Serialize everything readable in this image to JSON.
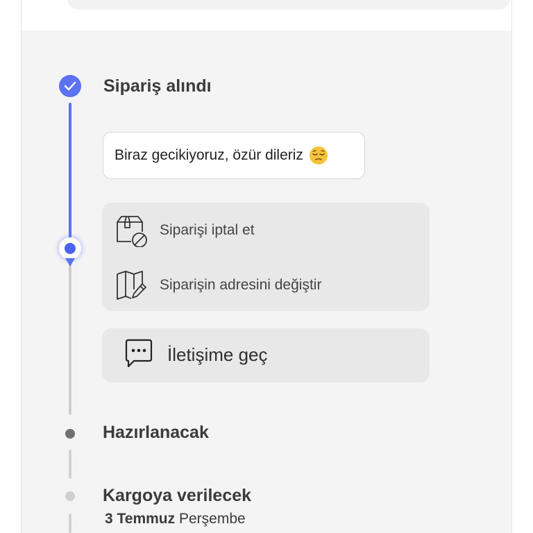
{
  "timeline": {
    "steps": [
      {
        "title": "Sipariş alındı",
        "status": "done"
      },
      {
        "title": "Hazırlanacak",
        "status": "pending"
      },
      {
        "title": "Kargoya verilecek",
        "status": "upcoming",
        "date_bold": "3 Temmuz",
        "date_rest": " Perşembe"
      }
    ]
  },
  "message": {
    "text": "Biraz gecikiyoruz, özür dileriz",
    "emoji": "pensive-face"
  },
  "actions": [
    {
      "label": "Siparişi iptal et",
      "icon": "box-cancel-icon"
    },
    {
      "label": "Siparişin adresini değiştir",
      "icon": "map-edit-icon"
    }
  ],
  "contact": {
    "label": "İletişime geç",
    "icon": "chat-icon"
  },
  "colors": {
    "accent": "#5b73f0",
    "panel": "#f4f4f4",
    "card": "#e8e8e8"
  }
}
